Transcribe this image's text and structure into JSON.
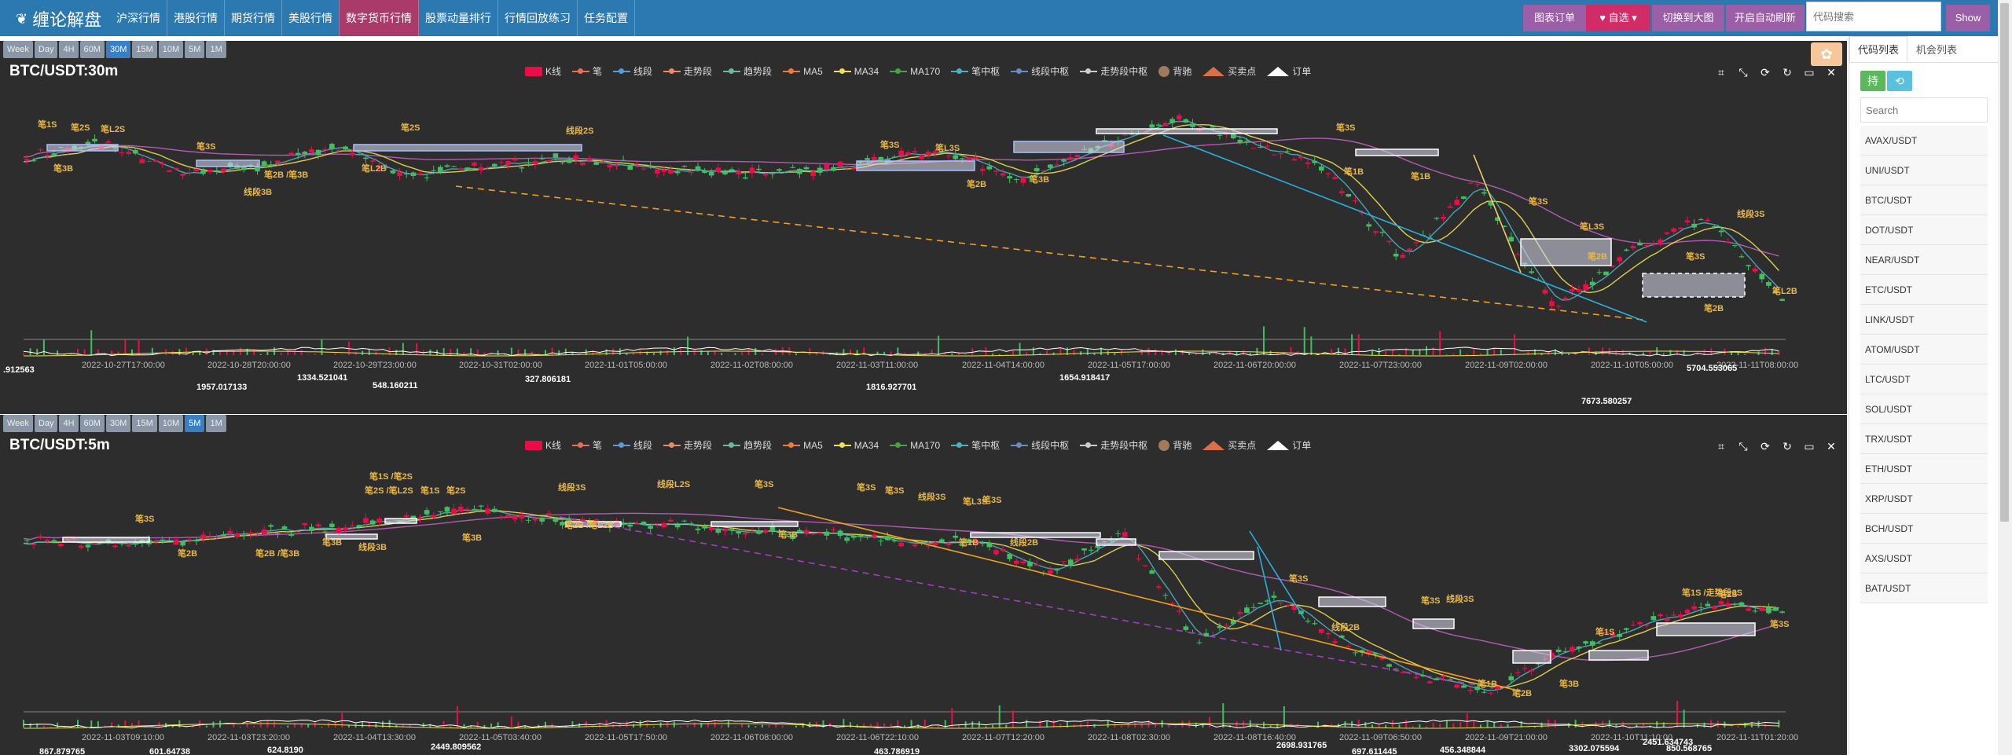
{
  "app": {
    "brand": "缠论解盘",
    "nav": [
      "沪深行情",
      "港股行情",
      "期货行情",
      "美股行情",
      "数字货币行情",
      "股票动量排行",
      "行情回放练习",
      "任务配置"
    ],
    "active_nav": 4
  },
  "topbar": {
    "chart_order": "图表订单",
    "watchlist": "自选",
    "switch_big": "切换到大图",
    "auto_refresh": "开启自动刷新",
    "search_placeholder": "代码搜索",
    "show": "Show"
  },
  "colors": {
    "nav_bg": "#2b79b0",
    "active_nav": "#a93a6a",
    "chart_bg": "#2d2d2d",
    "kline": "#ec0d48",
    "bi": "#ea6e5a",
    "xianduan": "#5b9bd5",
    "ma5": "#ea7d3c",
    "ma34": "#f0e050",
    "ma170": "#4ca04a"
  },
  "chart1": {
    "title": "BTC/USDT:30m",
    "timeframes": [
      "Week",
      "Day",
      "4H",
      "60M",
      "30M",
      "15M",
      "10M",
      "5M",
      "1M"
    ],
    "active_tf": 4,
    "x_ticks": [
      "2022-10-27T17:00:00",
      "2022-10-28T20:00:00",
      "2022-10-29T23:00:00",
      "2022-10-31T02:00:00",
      "2022-11-01T05:00:00",
      "2022-11-02T08:00:00",
      "2022-11-03T11:00:00",
      "2022-11-04T14:00:00",
      "2022-11-05T17:00:00",
      "2022-11-06T20:00:00",
      "2022-11-07T23:00:00",
      "2022-11-09T02:00:00",
      "2022-11-10T05:00:00",
      "2022-11-11T08:00:00"
    ],
    "value_labels": [
      ".912563",
      "1957.017133",
      "1334.521041",
      "548.160211",
      "327.806181",
      "1816.927701",
      "1654.918417",
      "5704.553065",
      "7673.580257"
    ],
    "annotations": [
      "笔1S",
      "笔2S",
      "笔L2S",
      "笔3B",
      "笔3S",
      "笔2B /笔3B",
      "线段3B",
      "笔L2B",
      "笔2S",
      "线段2S",
      "笔3S",
      "笔L3S",
      "笔2B",
      "笔3B",
      "笔3S",
      "笔1B",
      "笔1B",
      "笔3S",
      "笔L3S",
      "笔2B",
      "笔3S",
      "笔2B",
      "线段3S",
      "笔L2B"
    ]
  },
  "chart2": {
    "title": "BTC/USDT:5m",
    "timeframes": [
      "Week",
      "Day",
      "4H",
      "60M",
      "30M",
      "15M",
      "10M",
      "5M",
      "1M"
    ],
    "active_tf": 7,
    "x_ticks": [
      "2022-11-03T09:10:00",
      "2022-11-03T23:20:00",
      "2022-11-04T13:30:00",
      "2022-11-05T03:40:00",
      "2022-11-05T17:50:00",
      "2022-11-06T08:00:00",
      "2022-11-06T22:10:00",
      "2022-11-07T12:20:00",
      "2022-11-08T02:30:00",
      "2022-11-08T16:40:00",
      "2022-11-09T06:50:00",
      "2022-11-09T21:00:00",
      "2022-11-10T11:10:00",
      "2022-11-11T01:20:00"
    ],
    "value_labels": [
      "867.879765",
      "601.64738",
      "624.8190",
      "2449.809562",
      "463.786919",
      "2698.931765",
      "697.611445",
      "456.348844",
      "3302.075594",
      "2451.634743",
      "850.568765"
    ],
    "annotations": [
      "笔1S /笔2S",
      "笔2S /笔L2S",
      "笔1S",
      "笔2S",
      "线段3S",
      "线段L2S",
      "笔3S",
      "笔3S",
      "笔3S",
      "线段3S",
      "笔3S",
      "笔L3S",
      "笔3S",
      "笔2B",
      "笔2B /笔3B",
      "笔3B",
      "线段3B",
      "笔3B",
      "笔2B /笔L2B",
      "笔3B",
      "笔1B",
      "线段2B",
      "笔3S",
      "线段2B",
      "笔3S",
      "线段3S",
      "笔1S",
      "笔1S /走势段3S",
      "笔2S",
      "笔3S",
      "笔1B",
      "笔2B",
      "笔3B"
    ]
  },
  "legend": [
    "K线",
    "笔",
    "线段",
    "走势段",
    "趋势段",
    "MA5",
    "MA34",
    "MA170",
    "笔中枢",
    "线段中枢",
    "走势段中枢",
    "背驰",
    "买卖点",
    "订单"
  ],
  "right_panel": {
    "tabs": [
      "代码列表",
      "机会列表"
    ],
    "btn_hold": "持",
    "btn_refresh": "⟲",
    "search_placeholder": "Search",
    "symbols": [
      "AVAX/USDT",
      "UNI/USDT",
      "BTC/USDT",
      "DOT/USDT",
      "NEAR/USDT",
      "ETC/USDT",
      "LINK/USDT",
      "ATOM/USDT",
      "LTC/USDT",
      "SOL/USDT",
      "TRX/USDT",
      "ETH/USDT",
      "XRP/USDT",
      "BCH/USDT",
      "AXS/USDT",
      "BAT/USDT"
    ]
  }
}
